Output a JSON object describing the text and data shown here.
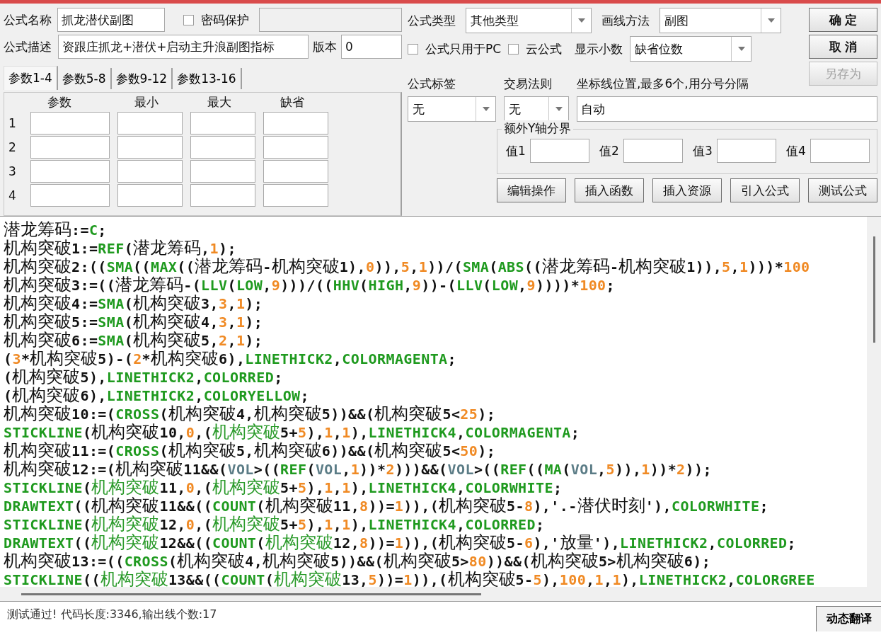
{
  "header": {
    "name_label": "公式名称",
    "name_value": "抓龙潜伏副图",
    "password": {
      "label": "密码保护",
      "checked": false
    },
    "password_field": {
      "disabled": true
    },
    "description_label": "公式描述",
    "description_value": "资跟庄抓龙+潜伏+启动主升浪副图指标",
    "version_label": "版本",
    "version_value": "0"
  },
  "settings": {
    "type": {
      "label": "公式类型",
      "value": "其他类型"
    },
    "draw": {
      "label": "画线方法",
      "value": "副图"
    },
    "pc_only": {
      "label": "公式只用于PC",
      "checked": false
    },
    "cloud": {
      "label": "云公式",
      "checked": false
    },
    "decimals": {
      "label": "显示小数",
      "value": "缺省位数"
    }
  },
  "action_buttons": [
    {
      "label": "确 定",
      "disabled": false
    },
    {
      "label": "取 消",
      "disabled": false
    },
    {
      "label": "另存为",
      "disabled": true
    }
  ],
  "param_tabs": [
    {
      "label": "参数1-4",
      "selected": true
    },
    {
      "label": "参数5-8",
      "selected": false
    },
    {
      "label": "参数9-12",
      "selected": false
    },
    {
      "label": "参数13-16",
      "selected": false
    }
  ],
  "param_columns": [
    "参数",
    "最小",
    "最大",
    "缺省"
  ],
  "param_rows": [
    "1",
    "2",
    "3",
    "4"
  ],
  "tag": {
    "label": "公式标签",
    "value": "无"
  },
  "trade_rule": {
    "label": "交易法则",
    "value": "无"
  },
  "axis_lines": {
    "label": "坐标线位置,最多6个,用分号分隔",
    "value": "自动"
  },
  "y_bounds": {
    "title": "额外Y轴分界",
    "labels": [
      "值1",
      "值2",
      "值3",
      "值4"
    ]
  },
  "tool_buttons": [
    "编辑操作",
    "插入函数",
    "插入资源",
    "引入公式",
    "测试公式"
  ],
  "code_lines": [
    [
      {
        "kind": "plain",
        "text": "潜龙筹码:="
      },
      {
        "kind": "func",
        "text": "C"
      },
      {
        "kind": "plain",
        "text": ";"
      }
    ],
    [
      {
        "kind": "plain",
        "text": "机构突破1:="
      },
      {
        "kind": "func",
        "text": "REF"
      },
      {
        "kind": "plain",
        "text": "(潜龙筹码,"
      },
      {
        "kind": "num",
        "text": "1"
      },
      {
        "kind": "plain",
        "text": ");"
      }
    ],
    [
      {
        "kind": "plain",
        "text": "机构突破2:(("
      },
      {
        "kind": "func",
        "text": "SMA"
      },
      {
        "kind": "plain",
        "text": "(("
      },
      {
        "kind": "func",
        "text": "MAX"
      },
      {
        "kind": "plain",
        "text": "((潜龙筹码-机构突破1),"
      },
      {
        "kind": "num",
        "text": "0"
      },
      {
        "kind": "plain",
        "text": ")),"
      },
      {
        "kind": "num",
        "text": "5"
      },
      {
        "kind": "plain",
        "text": ","
      },
      {
        "kind": "num",
        "text": "1"
      },
      {
        "kind": "plain",
        "text": "))/("
      },
      {
        "kind": "func",
        "text": "SMA"
      },
      {
        "kind": "plain",
        "text": "("
      },
      {
        "kind": "func",
        "text": "ABS"
      },
      {
        "kind": "plain",
        "text": "((潜龙筹码-机构突破1)),"
      },
      {
        "kind": "num",
        "text": "5"
      },
      {
        "kind": "plain",
        "text": ","
      },
      {
        "kind": "num",
        "text": "1"
      },
      {
        "kind": "plain",
        "text": ")))*"
      },
      {
        "kind": "num",
        "text": "100"
      }
    ],
    [
      {
        "kind": "plain",
        "text": "机构突破3:=((潜龙筹码-("
      },
      {
        "kind": "func",
        "text": "LLV"
      },
      {
        "kind": "plain",
        "text": "("
      },
      {
        "kind": "func",
        "text": "LOW"
      },
      {
        "kind": "plain",
        "text": ","
      },
      {
        "kind": "num",
        "text": "9"
      },
      {
        "kind": "plain",
        "text": ")))/(("
      },
      {
        "kind": "func",
        "text": "HHV"
      },
      {
        "kind": "plain",
        "text": "("
      },
      {
        "kind": "func",
        "text": "HIGH"
      },
      {
        "kind": "plain",
        "text": ","
      },
      {
        "kind": "num",
        "text": "9"
      },
      {
        "kind": "plain",
        "text": "))-("
      },
      {
        "kind": "func",
        "text": "LLV"
      },
      {
        "kind": "plain",
        "text": "("
      },
      {
        "kind": "func",
        "text": "LOW"
      },
      {
        "kind": "plain",
        "text": ","
      },
      {
        "kind": "num",
        "text": "9"
      },
      {
        "kind": "plain",
        "text": "))))*"
      },
      {
        "kind": "num",
        "text": "100"
      },
      {
        "kind": "plain",
        "text": ";"
      }
    ],
    [
      {
        "kind": "plain",
        "text": "机构突破4:="
      },
      {
        "kind": "func",
        "text": "SMA"
      },
      {
        "kind": "plain",
        "text": "(机构突破3,"
      },
      {
        "kind": "num",
        "text": "3"
      },
      {
        "kind": "plain",
        "text": ","
      },
      {
        "kind": "num",
        "text": "1"
      },
      {
        "kind": "plain",
        "text": ");"
      }
    ],
    [
      {
        "kind": "plain",
        "text": "机构突破5:="
      },
      {
        "kind": "func",
        "text": "SMA"
      },
      {
        "kind": "plain",
        "text": "(机构突破4,"
      },
      {
        "kind": "num",
        "text": "3"
      },
      {
        "kind": "plain",
        "text": ","
      },
      {
        "kind": "num",
        "text": "1"
      },
      {
        "kind": "plain",
        "text": ");"
      }
    ],
    [
      {
        "kind": "plain",
        "text": "机构突破6:="
      },
      {
        "kind": "func",
        "text": "SMA"
      },
      {
        "kind": "plain",
        "text": "(机构突破5,"
      },
      {
        "kind": "num",
        "text": "2"
      },
      {
        "kind": "plain",
        "text": ","
      },
      {
        "kind": "num",
        "text": "1"
      },
      {
        "kind": "plain",
        "text": ");"
      }
    ],
    [
      {
        "kind": "plain",
        "text": "("
      },
      {
        "kind": "num",
        "text": "3"
      },
      {
        "kind": "plain",
        "text": "*机构突破5)-("
      },
      {
        "kind": "num",
        "text": "2"
      },
      {
        "kind": "plain",
        "text": "*机构突破6),"
      },
      {
        "kind": "func",
        "text": "LINETHICK2"
      },
      {
        "kind": "plain",
        "text": ","
      },
      {
        "kind": "func",
        "text": "COLORMAGENTA"
      },
      {
        "kind": "plain",
        "text": ";"
      }
    ],
    [
      {
        "kind": "plain",
        "text": "(机构突破5),"
      },
      {
        "kind": "func",
        "text": "LINETHICK2"
      },
      {
        "kind": "plain",
        "text": ","
      },
      {
        "kind": "func",
        "text": "COLORRED"
      },
      {
        "kind": "plain",
        "text": ";"
      }
    ],
    [
      {
        "kind": "plain",
        "text": "(机构突破6),"
      },
      {
        "kind": "func",
        "text": "LINETHICK2"
      },
      {
        "kind": "plain",
        "text": ","
      },
      {
        "kind": "func",
        "text": "COLORYELLOW"
      },
      {
        "kind": "plain",
        "text": ";"
      }
    ],
    [
      {
        "kind": "plain",
        "text": "机构突破10:=("
      },
      {
        "kind": "func",
        "text": "CROSS"
      },
      {
        "kind": "plain",
        "text": "(机构突破4,机构突破5))&&(机构突破5<"
      },
      {
        "kind": "num",
        "text": "25"
      },
      {
        "kind": "plain",
        "text": ");"
      }
    ],
    [
      {
        "kind": "func",
        "text": "STICKLINE"
      },
      {
        "kind": "plain",
        "text": "(机构突破10,"
      },
      {
        "kind": "num",
        "text": "0"
      },
      {
        "kind": "plain",
        "text": ",("
      },
      {
        "kind": "hl",
        "text": "机构突破"
      },
      {
        "kind": "plain",
        "text": "5+"
      },
      {
        "kind": "num",
        "text": "5"
      },
      {
        "kind": "plain",
        "text": "),"
      },
      {
        "kind": "num",
        "text": "1"
      },
      {
        "kind": "plain",
        "text": ","
      },
      {
        "kind": "num",
        "text": "1"
      },
      {
        "kind": "plain",
        "text": "),"
      },
      {
        "kind": "func",
        "text": "LINETHICK4"
      },
      {
        "kind": "plain",
        "text": ","
      },
      {
        "kind": "func",
        "text": "COLORMAGENTA"
      },
      {
        "kind": "plain",
        "text": ";"
      }
    ],
    [
      {
        "kind": "plain",
        "text": "机构突破11:=("
      },
      {
        "kind": "func",
        "text": "CROSS"
      },
      {
        "kind": "plain",
        "text": "(机构突破5,机构突破6))&&(机构突破5<"
      },
      {
        "kind": "num",
        "text": "50"
      },
      {
        "kind": "plain",
        "text": ");"
      }
    ],
    [
      {
        "kind": "plain",
        "text": "机构突破12:=(机构突破11&&("
      },
      {
        "kind": "var",
        "text": "VOL"
      },
      {
        "kind": "plain",
        "text": ">(("
      },
      {
        "kind": "func",
        "text": "REF"
      },
      {
        "kind": "plain",
        "text": "("
      },
      {
        "kind": "var",
        "text": "VOL"
      },
      {
        "kind": "plain",
        "text": ","
      },
      {
        "kind": "num",
        "text": "1"
      },
      {
        "kind": "plain",
        "text": "))*"
      },
      {
        "kind": "num",
        "text": "2"
      },
      {
        "kind": "plain",
        "text": ")))&&("
      },
      {
        "kind": "var",
        "text": "VOL"
      },
      {
        "kind": "plain",
        "text": ">(("
      },
      {
        "kind": "func",
        "text": "REF"
      },
      {
        "kind": "plain",
        "text": "(("
      },
      {
        "kind": "func",
        "text": "MA"
      },
      {
        "kind": "plain",
        "text": "("
      },
      {
        "kind": "var",
        "text": "VOL"
      },
      {
        "kind": "plain",
        "text": ","
      },
      {
        "kind": "num",
        "text": "5"
      },
      {
        "kind": "plain",
        "text": ")),"
      },
      {
        "kind": "num",
        "text": "1"
      },
      {
        "kind": "plain",
        "text": "))*"
      },
      {
        "kind": "num",
        "text": "2"
      },
      {
        "kind": "plain",
        "text": "));"
      }
    ],
    [
      {
        "kind": "func",
        "text": "STICKLINE"
      },
      {
        "kind": "plain",
        "text": "("
      },
      {
        "kind": "hl",
        "text": "机构突破"
      },
      {
        "kind": "plain",
        "text": "11,"
      },
      {
        "kind": "num",
        "text": "0"
      },
      {
        "kind": "plain",
        "text": ",("
      },
      {
        "kind": "hl",
        "text": "机构突破"
      },
      {
        "kind": "plain",
        "text": "5+"
      },
      {
        "kind": "num",
        "text": "5"
      },
      {
        "kind": "plain",
        "text": "),"
      },
      {
        "kind": "num",
        "text": "1"
      },
      {
        "kind": "plain",
        "text": ","
      },
      {
        "kind": "num",
        "text": "1"
      },
      {
        "kind": "plain",
        "text": "),"
      },
      {
        "kind": "func",
        "text": "LINETHICK4"
      },
      {
        "kind": "plain",
        "text": ","
      },
      {
        "kind": "func",
        "text": "COLORWHITE"
      },
      {
        "kind": "plain",
        "text": ";"
      }
    ],
    [
      {
        "kind": "func",
        "text": "DRAWTEXT"
      },
      {
        "kind": "plain",
        "text": "((机构突破11&&(("
      },
      {
        "kind": "func",
        "text": "COUNT"
      },
      {
        "kind": "plain",
        "text": "(机构突破11,"
      },
      {
        "kind": "num",
        "text": "8"
      },
      {
        "kind": "plain",
        "text": "))="
      },
      {
        "kind": "num",
        "text": "1"
      },
      {
        "kind": "plain",
        "text": ")),(机构突破5-"
      },
      {
        "kind": "num",
        "text": "8"
      },
      {
        "kind": "plain",
        "text": "),'.-潜伏时刻'),"
      },
      {
        "kind": "func",
        "text": "COLORWHITE"
      },
      {
        "kind": "plain",
        "text": ";"
      }
    ],
    [
      {
        "kind": "func",
        "text": "STICKLINE"
      },
      {
        "kind": "plain",
        "text": "("
      },
      {
        "kind": "hl",
        "text": "机构突破"
      },
      {
        "kind": "plain",
        "text": "12,"
      },
      {
        "kind": "num",
        "text": "0"
      },
      {
        "kind": "plain",
        "text": ",("
      },
      {
        "kind": "hl",
        "text": "机构突破"
      },
      {
        "kind": "plain",
        "text": "5+"
      },
      {
        "kind": "num",
        "text": "5"
      },
      {
        "kind": "plain",
        "text": "),"
      },
      {
        "kind": "num",
        "text": "1"
      },
      {
        "kind": "plain",
        "text": ","
      },
      {
        "kind": "num",
        "text": "1"
      },
      {
        "kind": "plain",
        "text": "),"
      },
      {
        "kind": "func",
        "text": "LINETHICK4"
      },
      {
        "kind": "plain",
        "text": ","
      },
      {
        "kind": "func",
        "text": "COLORRED"
      },
      {
        "kind": "plain",
        "text": ";"
      }
    ],
    [
      {
        "kind": "func",
        "text": "DRAWTEXT"
      },
      {
        "kind": "plain",
        "text": "(("
      },
      {
        "kind": "hl",
        "text": "机构突破"
      },
      {
        "kind": "plain",
        "text": "12&&(("
      },
      {
        "kind": "func",
        "text": "COUNT"
      },
      {
        "kind": "plain",
        "text": "("
      },
      {
        "kind": "hl",
        "text": "机构突破"
      },
      {
        "kind": "plain",
        "text": "12,"
      },
      {
        "kind": "num",
        "text": "8"
      },
      {
        "kind": "plain",
        "text": "))="
      },
      {
        "kind": "num",
        "text": "1"
      },
      {
        "kind": "plain",
        "text": ")),(机构突破5-"
      },
      {
        "kind": "num",
        "text": "6"
      },
      {
        "kind": "plain",
        "text": "),'放量'),"
      },
      {
        "kind": "func",
        "text": "LINETHICK2"
      },
      {
        "kind": "plain",
        "text": ","
      },
      {
        "kind": "func",
        "text": "COLORRED"
      },
      {
        "kind": "plain",
        "text": ";"
      }
    ],
    [
      {
        "kind": "plain",
        "text": "机构突破13:=(("
      },
      {
        "kind": "func",
        "text": "CROSS"
      },
      {
        "kind": "plain",
        "text": "(机构突破4,机构突破5))&&(机构突破5>"
      },
      {
        "kind": "num",
        "text": "80"
      },
      {
        "kind": "plain",
        "text": "))&&(机构突破5>机构突破6);"
      }
    ],
    [
      {
        "kind": "func",
        "text": "STICKLINE"
      },
      {
        "kind": "plain",
        "text": "(("
      },
      {
        "kind": "hl",
        "text": "机构突破"
      },
      {
        "kind": "plain",
        "text": "13&&(("
      },
      {
        "kind": "func",
        "text": "COUNT"
      },
      {
        "kind": "plain",
        "text": "("
      },
      {
        "kind": "hl",
        "text": "机构突破"
      },
      {
        "kind": "plain",
        "text": "13,"
      },
      {
        "kind": "num",
        "text": "5"
      },
      {
        "kind": "plain",
        "text": "))="
      },
      {
        "kind": "num",
        "text": "1"
      },
      {
        "kind": "plain",
        "text": ")),(机构突破5-"
      },
      {
        "kind": "num",
        "text": "5"
      },
      {
        "kind": "plain",
        "text": "),"
      },
      {
        "kind": "num",
        "text": "100"
      },
      {
        "kind": "plain",
        "text": ","
      },
      {
        "kind": "num",
        "text": "1"
      },
      {
        "kind": "plain",
        "text": ","
      },
      {
        "kind": "num",
        "text": "1"
      },
      {
        "kind": "plain",
        "text": "),"
      },
      {
        "kind": "func",
        "text": "LINETHICK2"
      },
      {
        "kind": "plain",
        "text": ","
      },
      {
        "kind": "func",
        "text": "COLORGREE"
      }
    ]
  ],
  "status": {
    "message": "测试通过! 代码长度:3346,输出线个数:17",
    "button": "动态翻译"
  }
}
